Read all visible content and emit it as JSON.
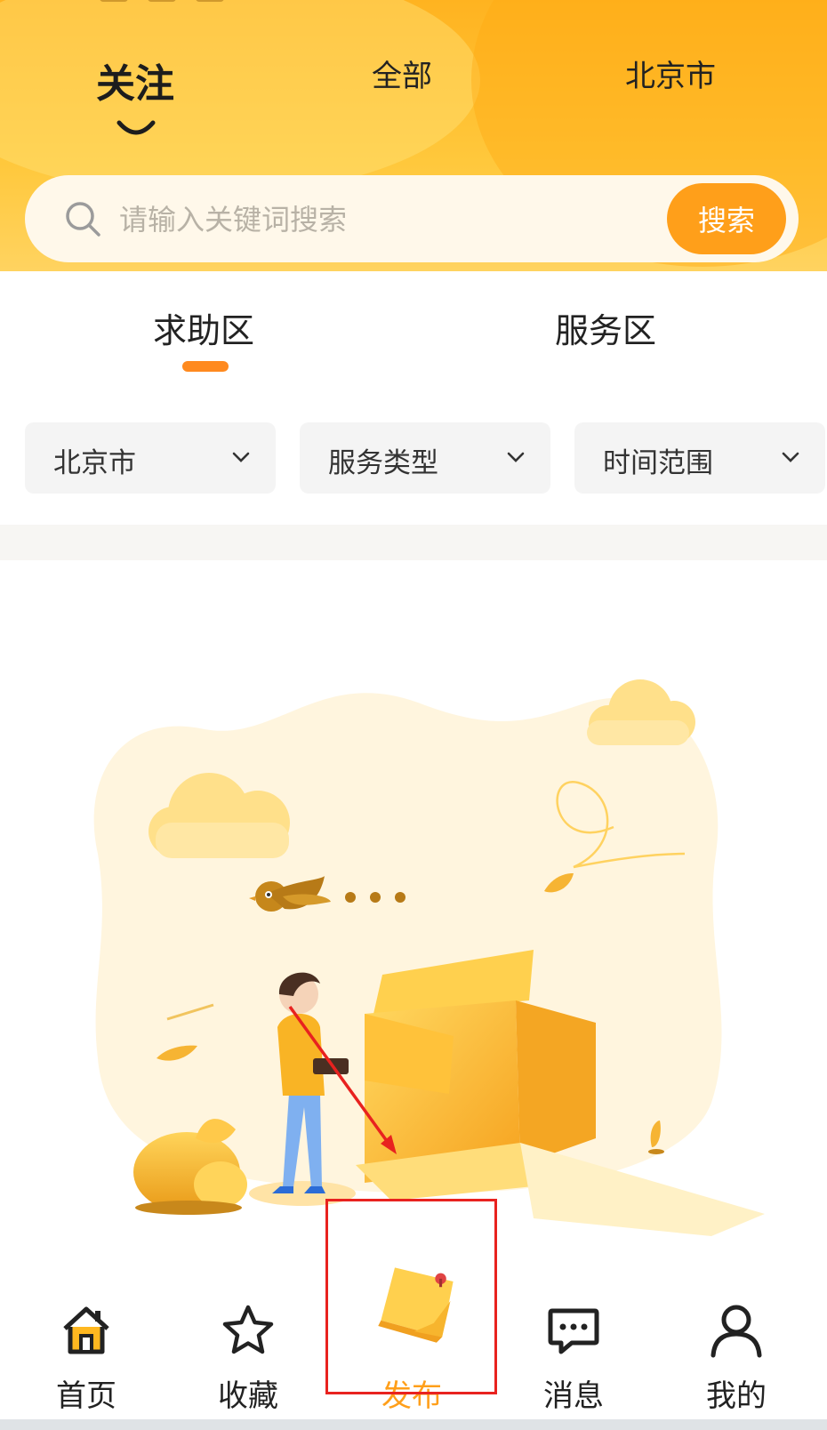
{
  "header": {
    "tabs": [
      {
        "label": "关注",
        "active": true
      },
      {
        "label": "全部",
        "active": false
      },
      {
        "label": "北京市",
        "active": false
      }
    ],
    "search": {
      "placeholder": "请输入关键词搜索",
      "value": "",
      "button_label": "搜索"
    }
  },
  "sections": {
    "tabs": [
      {
        "label": "求助区",
        "active": true
      },
      {
        "label": "服务区",
        "active": false
      }
    ],
    "filters": [
      {
        "label": "北京市",
        "icon": "chevron-down-icon"
      },
      {
        "label": "服务类型",
        "icon": "chevron-down-icon"
      },
      {
        "label": "时间范围",
        "icon": "chevron-down-icon"
      }
    ]
  },
  "empty_state": {
    "illustration": "person-with-empty-box-illustration"
  },
  "bottom_nav": [
    {
      "label": "首页",
      "icon": "home-icon"
    },
    {
      "label": "收藏",
      "icon": "star-icon"
    },
    {
      "label": "发布",
      "icon": "sticky-note-icon",
      "active": true
    },
    {
      "label": "消息",
      "icon": "message-icon"
    },
    {
      "label": "我的",
      "icon": "user-icon"
    }
  ],
  "colors": {
    "brand_orange": "#ff9f1a",
    "header_yellow": "#ffc83c",
    "annotation_red": "#e8221f"
  }
}
